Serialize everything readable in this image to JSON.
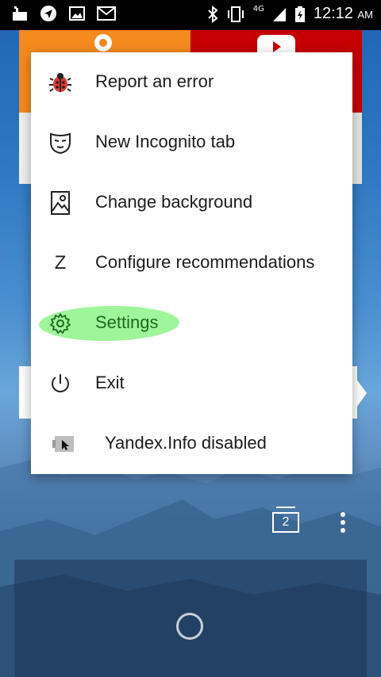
{
  "status_bar": {
    "time": "12:12",
    "ampm": "AM",
    "network": "4G",
    "icons": [
      "notification-icon",
      "telegram-icon",
      "image-icon",
      "mail-icon",
      "bluetooth-icon",
      "vibrate-icon",
      "signal-icon",
      "battery-charging-icon"
    ]
  },
  "menu": {
    "items": [
      {
        "label": "Report an error",
        "icon": "bug-icon"
      },
      {
        "label": "New Incognito tab",
        "icon": "incognito-mask-icon"
      },
      {
        "label": "Change background",
        "icon": "image-icon"
      },
      {
        "label": "Configure recommendations",
        "icon": "z-icon",
        "glyph": "Z"
      },
      {
        "label": "Settings",
        "icon": "gear-icon"
      },
      {
        "label": "Exit",
        "icon": "power-icon"
      },
      {
        "label": "Yandex.Info disabled",
        "icon": "yandex-info-icon"
      }
    ]
  },
  "bottom_bar": {
    "tab_count": "2"
  },
  "colors": {
    "highlight": "#9ff59a",
    "tile_orange": "#f58a1f",
    "tile_red": "#c60000",
    "bug_red": "#e53935"
  }
}
